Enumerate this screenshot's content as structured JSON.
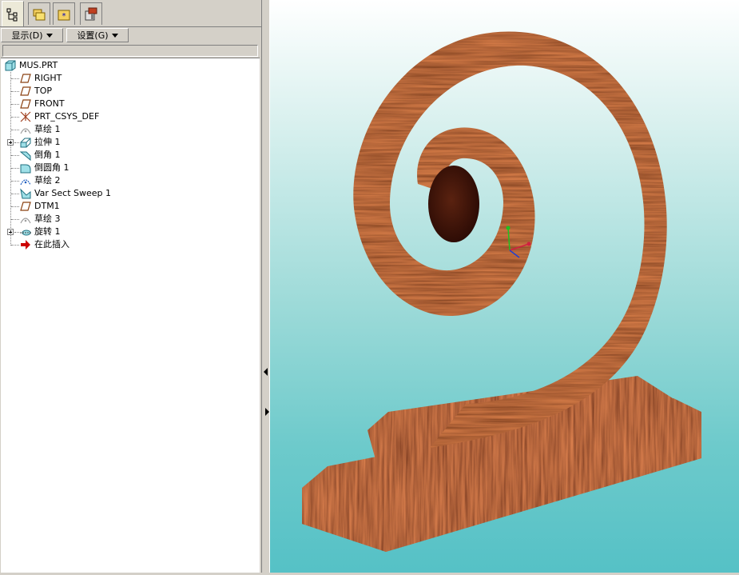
{
  "tabs": [
    {
      "icon": "model-tree-icon",
      "active": true
    },
    {
      "icon": "folder-browser-icon",
      "active": false
    },
    {
      "icon": "favorites-icon",
      "active": false
    },
    {
      "icon": "connections-icon",
      "active": false
    }
  ],
  "menu": {
    "display_label": "显示(D)",
    "settings_label": "设置(G)"
  },
  "tree": {
    "root": {
      "label": "MUS.PRT",
      "icon": "part-icon"
    },
    "items": [
      {
        "label": "RIGHT",
        "icon": "datum-plane-icon"
      },
      {
        "label": "TOP",
        "icon": "datum-plane-icon"
      },
      {
        "label": "FRONT",
        "icon": "datum-plane-icon"
      },
      {
        "label": "PRT_CSYS_DEF",
        "icon": "coordinate-system-icon"
      },
      {
        "label": "草绘 1",
        "icon": "sketch-icon"
      },
      {
        "label": "拉伸 1",
        "icon": "extrude-icon",
        "expandable": true
      },
      {
        "label": "倒角 1",
        "icon": "chamfer-icon"
      },
      {
        "label": "倒圆角 1",
        "icon": "round-icon"
      },
      {
        "label": "草绘 2",
        "icon": "sketch-icon"
      },
      {
        "label": "Var Sect Sweep 1",
        "icon": "sweep-icon"
      },
      {
        "label": "DTM1",
        "icon": "datum-plane-icon"
      },
      {
        "label": "草绘 3",
        "icon": "sketch-icon"
      },
      {
        "label": "旋转 1",
        "icon": "revolve-icon",
        "expandable": true
      },
      {
        "label": "在此插入",
        "icon": "insert-here-arrow-icon"
      }
    ]
  },
  "colors": {
    "wood_dark": "#3a0f05",
    "wood_mid": "#6e2410",
    "wood_light": "#9a4a22",
    "insert_arrow": "#cc0000"
  }
}
